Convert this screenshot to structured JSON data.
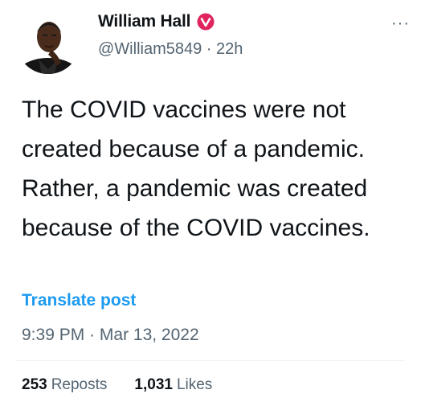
{
  "author": {
    "display_name": "William Hall",
    "handle": "@William5849",
    "separator": "·",
    "relative_time": "22h"
  },
  "more_label": "···",
  "tweet": {
    "text": "The COVID vaccines were not created because of a pandemic. Rather, a pandemic was created because of the COVID vaccines."
  },
  "translate_label": "Translate post",
  "timestamp": {
    "time": "9:39 PM",
    "separator": "·",
    "date": "Mar 13, 2022"
  },
  "stats": {
    "reposts_count": "253",
    "reposts_label": "Reposts",
    "likes_count": "1,031",
    "likes_label": "Likes"
  },
  "colors": {
    "verified_badge": "#e0245e",
    "link": "#1d9bf0",
    "secondary_text": "#536471"
  }
}
